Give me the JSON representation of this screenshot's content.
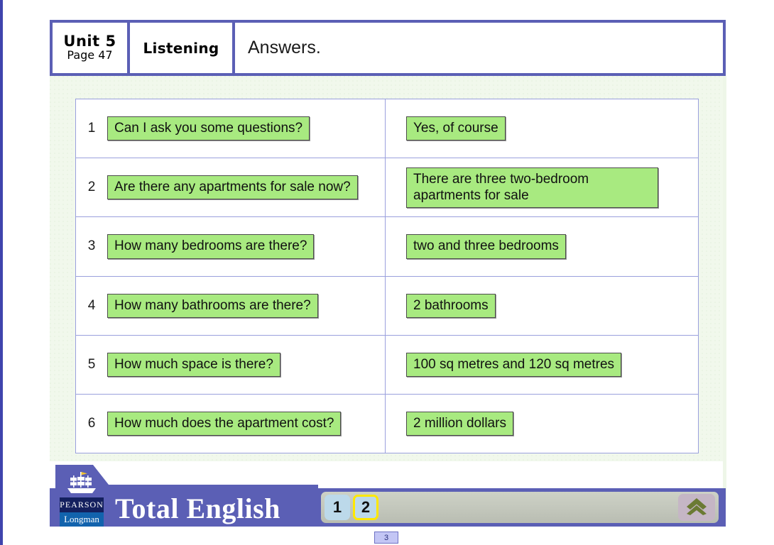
{
  "header": {
    "unit": "Unit 5",
    "page": "Page 47",
    "skill": "Listening",
    "title": "Answers."
  },
  "table": {
    "rows": [
      {
        "num": "1",
        "question": "Can I ask you some questions?",
        "answer": "Yes, of course"
      },
      {
        "num": "2",
        "question": "Are there any apartments for sale now?",
        "answer": "There are three two-bedroom apartments for sale"
      },
      {
        "num": "3",
        "question": "How many bedrooms are there?",
        "answer": "two and three bedrooms"
      },
      {
        "num": "4",
        "question": "How many bathrooms are there?",
        "answer": "2 bathrooms"
      },
      {
        "num": "5",
        "question": "How much space is there?",
        "answer": "100 sq metres and 120 sq metres"
      },
      {
        "num": "6",
        "question": "How much does the apartment cost?",
        "answer": "2 million dollars"
      }
    ]
  },
  "footer": {
    "brand_pearson": "PEARSON",
    "brand_longman": "Longman",
    "course_title": "Total English",
    "pages": [
      {
        "label": "1",
        "selected": false
      },
      {
        "label": "2",
        "selected": true
      }
    ],
    "up_icon": "double-chevron-up-icon",
    "ship_icon": "pearson-ship-icon"
  },
  "status": {
    "slide_number": "3"
  },
  "colors": {
    "frame_blue": "#5b5fb5",
    "slide_green": "#f1f8ec",
    "chip_green": "#a8ea80",
    "grid_line": "#9aa0dd",
    "selected_outline": "#ffe800"
  }
}
